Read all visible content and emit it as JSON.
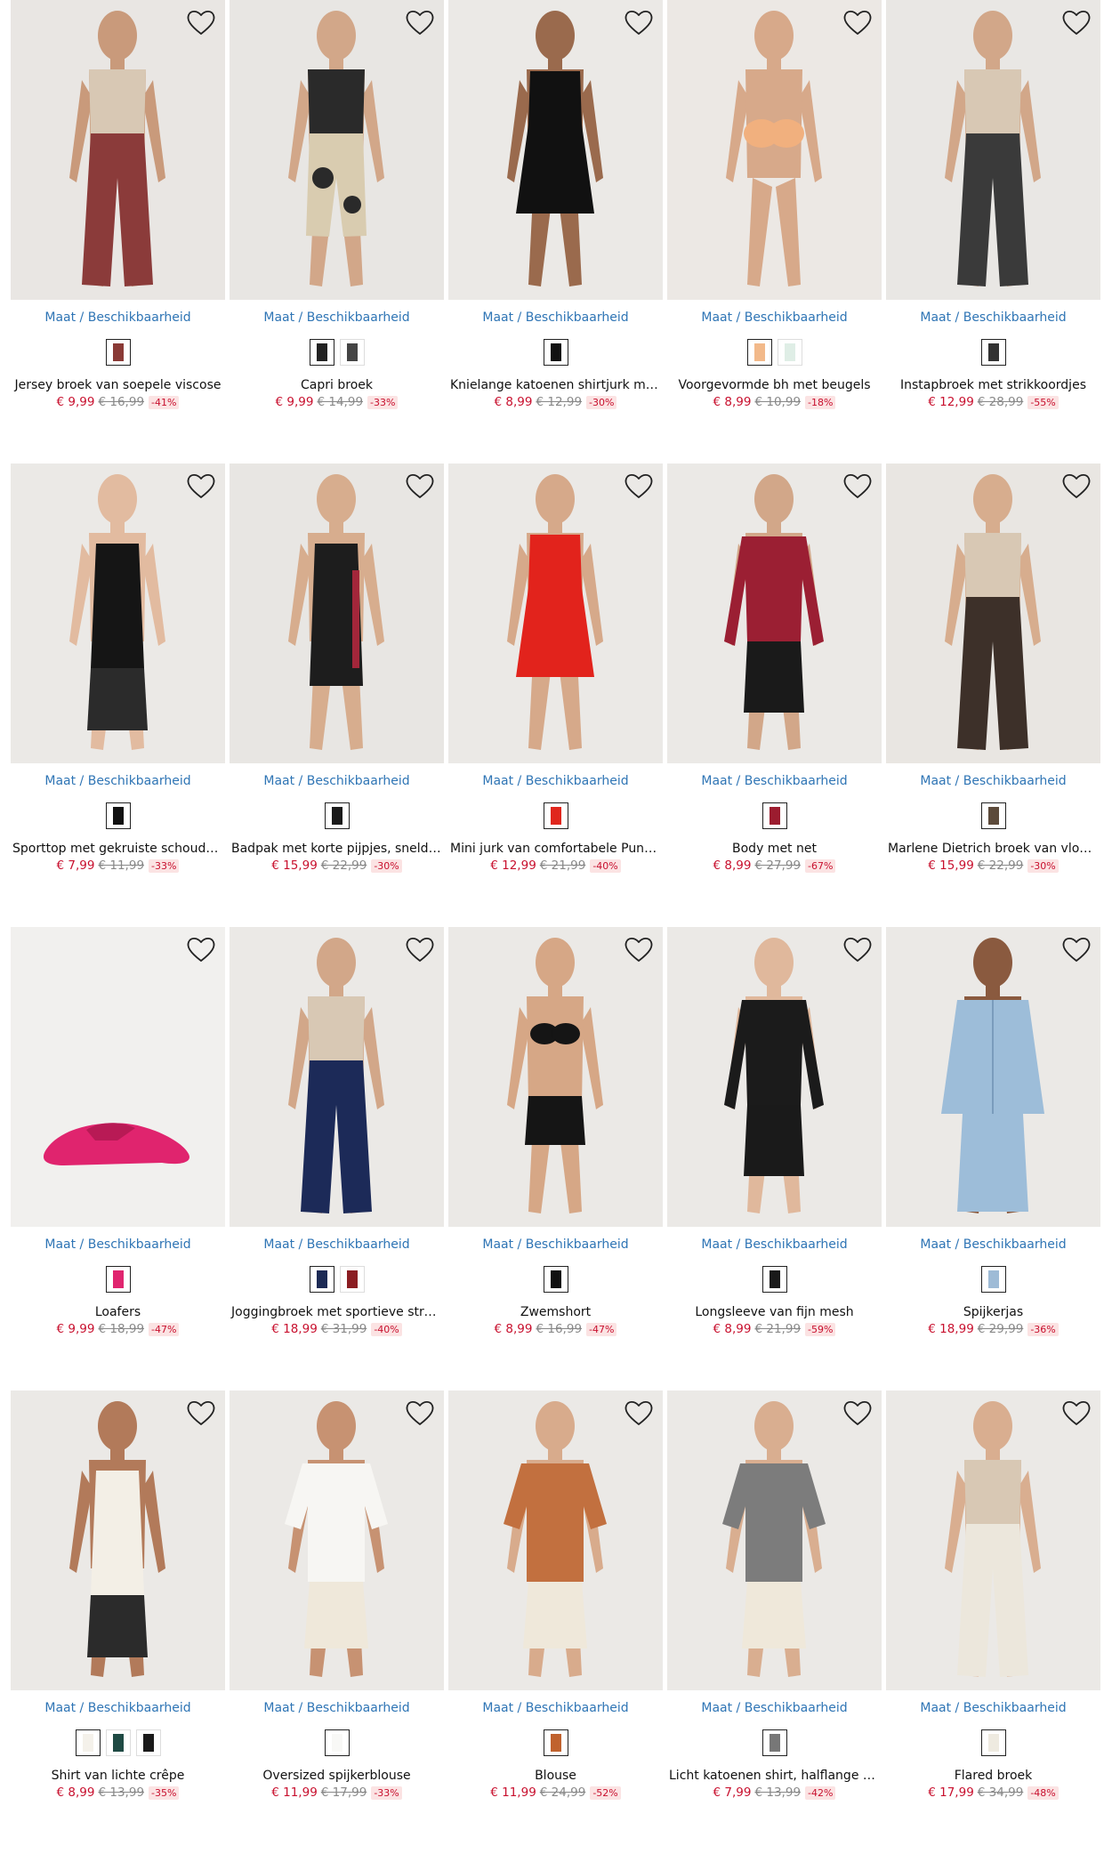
{
  "labels": {
    "size_link": "Maat / Beschikbaarheid"
  },
  "colors": {
    "link": "#2f75b5",
    "price": "#c8102e",
    "discount_bg": "#fbe3e3"
  },
  "products": [
    {
      "title": "Jersey broek van soepele viscose",
      "price": "€ 9,99",
      "old": "€ 16,99",
      "disc": "-41%",
      "swatches": [
        "#8a3a36"
      ],
      "bg": "#e9e6e3",
      "cloth": "#8b3b3a",
      "skin": "#c99a7b",
      "shape": "pants"
    },
    {
      "title": "Capri broek",
      "price": "€ 9,99",
      "old": "€ 14,99",
      "disc": "-33%",
      "swatches": [
        "#222222",
        "#444444"
      ],
      "bg": "#e8e6e3",
      "cloth": "#2a2a2a",
      "skin": "#d2a789",
      "shape": "capri"
    },
    {
      "title": "Knielange katoenen shirtjurk met k...",
      "price": "€ 8,99",
      "old": "€ 12,99",
      "disc": "-30%",
      "swatches": [
        "#111111"
      ],
      "bg": "#ebe9e6",
      "cloth": "#111111",
      "skin": "#9a6a4d",
      "shape": "dress"
    },
    {
      "title": "Voorgevormde bh met beugels",
      "price": "€ 8,99",
      "old": "€ 10,99",
      "disc": "-18%",
      "swatches": [
        "#f2b98a",
        "#dfeee6"
      ],
      "bg": "#ece8e4",
      "cloth": "#f1b07e",
      "skin": "#d7a98a",
      "shape": "bra"
    },
    {
      "title": "Instapbroek met strikkoordjes",
      "price": "€ 12,99",
      "old": "€ 28,99",
      "disc": "-55%",
      "swatches": [
        "#333333"
      ],
      "bg": "#e9e7e4",
      "cloth": "#3a3a3a",
      "skin": "#d2a789",
      "shape": "pants"
    },
    {
      "title": "Sporttop met gekruiste schouderb...",
      "price": "€ 7,99",
      "old": "€ 11,99",
      "disc": "-33%",
      "swatches": [
        "#111111"
      ],
      "bg": "#ebe9e6",
      "cloth": "#151515",
      "skin": "#e2bba0",
      "shape": "tank"
    },
    {
      "title": "Badpak met korte pijpjes, sneldrog...",
      "price": "€ 15,99",
      "old": "€ 22,99",
      "disc": "-30%",
      "swatches": [
        "#1a1a1a"
      ],
      "bg": "#e8e6e3",
      "cloth": "#1d1d1d",
      "skin": "#d7ad8e",
      "shape": "swimsuit"
    },
    {
      "title": "Mini jurk van comfortabele Punto d...",
      "price": "€ 12,99",
      "old": "€ 21,99",
      "disc": "-40%",
      "swatches": [
        "#e0261d"
      ],
      "bg": "#ebe9e6",
      "cloth": "#e2231c",
      "skin": "#d6a98a",
      "shape": "dress"
    },
    {
      "title": "Body met net",
      "price": "€ 8,99",
      "old": "€ 27,99",
      "disc": "-67%",
      "swatches": [
        "#9c1c2f"
      ],
      "bg": "#ebe9e6",
      "cloth": "#9b1f33",
      "skin": "#d2a789",
      "shape": "top"
    },
    {
      "title": "Marlene Dietrich broek van vloeien...",
      "price": "€ 15,99",
      "old": "€ 22,99",
      "disc": "-30%",
      "swatches": [
        "#5c4a3a"
      ],
      "bg": "#e9e6e2",
      "cloth": "#3d3029",
      "skin": "#d7ad8e",
      "shape": "pants"
    },
    {
      "title": "Loafers",
      "price": "€ 9,99",
      "old": "€ 18,99",
      "disc": "-47%",
      "swatches": [
        "#e0256f"
      ],
      "bg": "#f1f0ee",
      "cloth": "#e0246e",
      "skin": "#000000",
      "shape": "shoe"
    },
    {
      "title": "Joggingbroek met sportieve strepen",
      "price": "€ 18,99",
      "old": "€ 31,99",
      "disc": "-40%",
      "swatches": [
        "#1c2a55",
        "#8b1d22"
      ],
      "bg": "#ebe9e6",
      "cloth": "#1c2a58",
      "skin": "#d2a789",
      "shape": "pants"
    },
    {
      "title": "Zwemshort",
      "price": "€ 8,99",
      "old": "€ 16,99",
      "disc": "-47%",
      "swatches": [
        "#111111"
      ],
      "bg": "#ebe9e6",
      "cloth": "#151515",
      "skin": "#d6a786",
      "shape": "bikini"
    },
    {
      "title": "Longsleeve van fijn mesh",
      "price": "€ 8,99",
      "old": "€ 21,99",
      "disc": "-59%",
      "swatches": [
        "#1a1a1a"
      ],
      "bg": "#ebe9e6",
      "cloth": "#1b1b1b",
      "skin": "#e0b89c",
      "shape": "top"
    },
    {
      "title": "Spijkerjas",
      "price": "€ 18,99",
      "old": "€ 29,99",
      "disc": "-36%",
      "swatches": [
        "#9ebbd6"
      ],
      "bg": "#ebe9e6",
      "cloth": "#9dbdd9",
      "skin": "#8a5a3f",
      "shape": "jacket"
    },
    {
      "title": "Shirt van lichte crêpe",
      "price": "€ 8,99",
      "old": "€ 13,99",
      "disc": "-35%",
      "swatches": [
        "#f4f1ea",
        "#1f4a44",
        "#1a1a1a"
      ],
      "bg": "#ebe9e6",
      "cloth": "#f3efe6",
      "skin": "#b27a5a",
      "shape": "tank"
    },
    {
      "title": "Oversized spijkerblouse",
      "price": "€ 11,99",
      "old": "€ 17,99",
      "disc": "-33%",
      "swatches": [
        "#f8f8f6"
      ],
      "bg": "#ebe9e6",
      "cloth": "#f7f6f3",
      "skin": "#c79272",
      "shape": "shirt"
    },
    {
      "title": "Blouse",
      "price": "€ 11,99",
      "old": "€ 24,99",
      "disc": "-52%",
      "swatches": [
        "#c0622e"
      ],
      "bg": "#ebe9e6",
      "cloth": "#c2703f",
      "skin": "#d8ab8c",
      "shape": "shirt"
    },
    {
      "title": "Licht katoenen shirt, halflange mouw",
      "price": "€ 7,99",
      "old": "€ 13,99",
      "disc": "-42%",
      "swatches": [
        "#777777"
      ],
      "bg": "#ebe9e6",
      "cloth": "#7c7c7c",
      "skin": "#d9ae90",
      "shape": "shirt"
    },
    {
      "title": "Flared broek",
      "price": "€ 17,99",
      "old": "€ 34,99",
      "disc": "-48%",
      "swatches": [
        "#eeeae0"
      ],
      "bg": "#ebe9e6",
      "cloth": "#ece7dc",
      "skin": "#d9ae90",
      "shape": "pants"
    }
  ]
}
